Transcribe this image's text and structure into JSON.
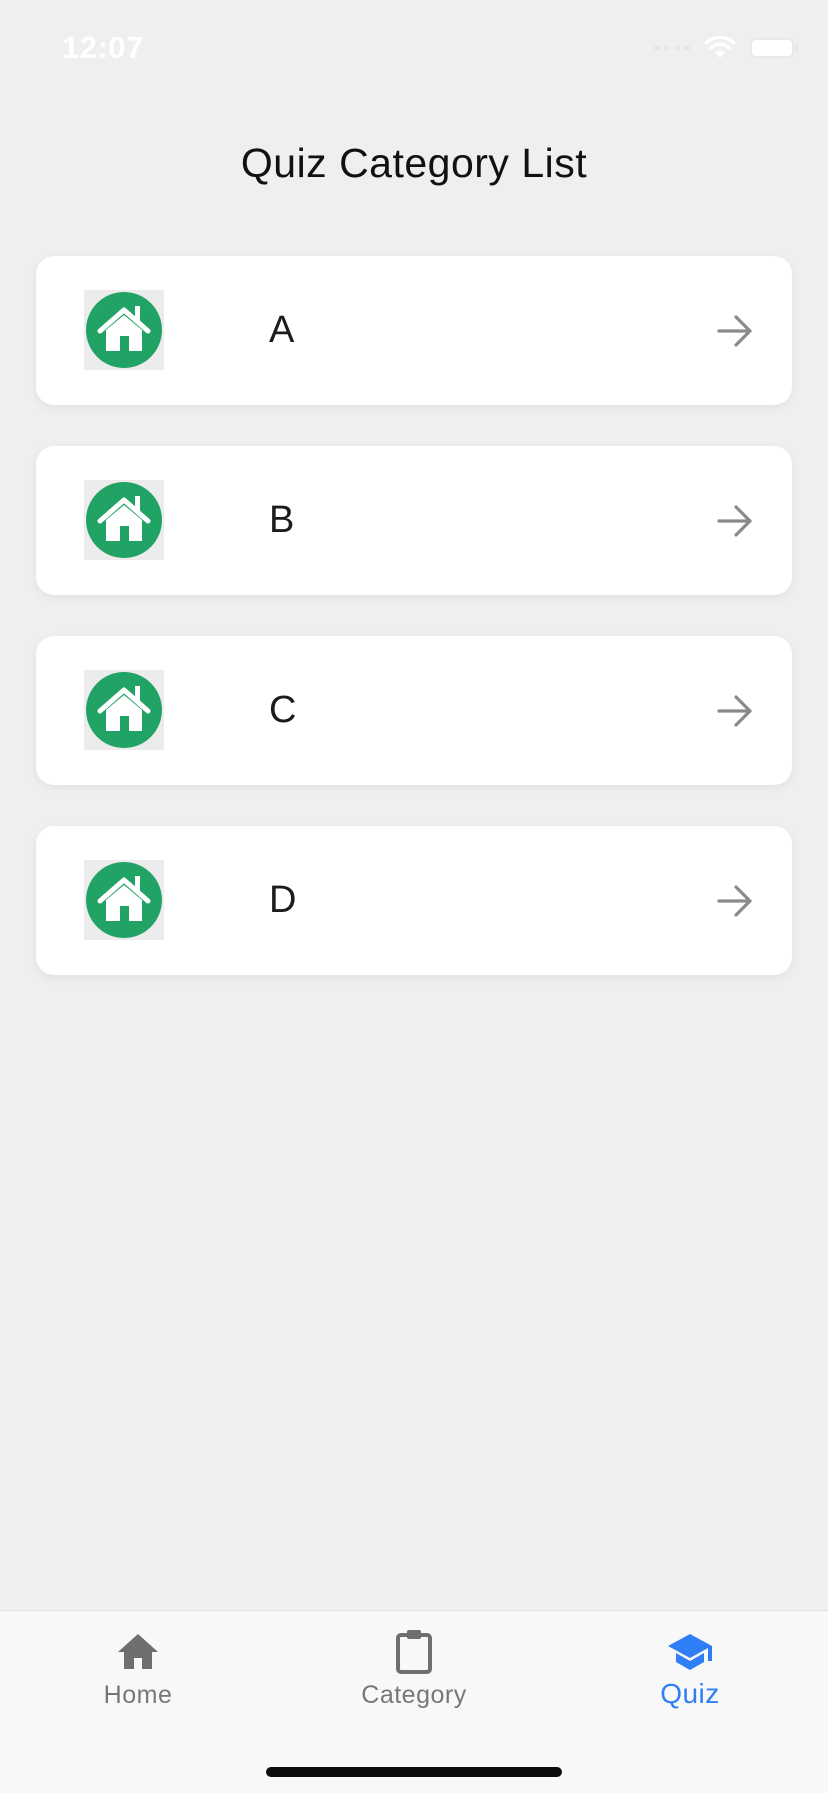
{
  "status_bar": {
    "time": "12:07"
  },
  "page": {
    "title": "Quiz Category List"
  },
  "categories": [
    {
      "label": "A"
    },
    {
      "label": "B"
    },
    {
      "label": "C"
    },
    {
      "label": "D"
    }
  ],
  "tabbar": {
    "tabs": [
      {
        "label": "Home",
        "icon": "home-icon",
        "active": false
      },
      {
        "label": "Category",
        "icon": "clipboard-icon",
        "active": false
      },
      {
        "label": "Quiz",
        "icon": "graduation-cap-icon",
        "active": true
      }
    ]
  },
  "colors": {
    "background": "#efefef",
    "card": "#ffffff",
    "thumb_green": "#21a366",
    "accent": "#2f7ef5",
    "inactive_tab": "#777777"
  }
}
